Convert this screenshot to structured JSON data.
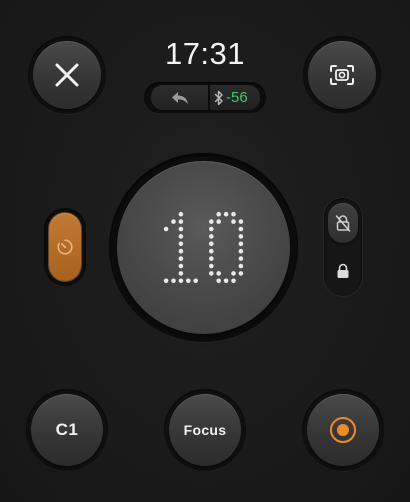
{
  "status": {
    "time": "17:31",
    "bluetooth_signal": "-56",
    "icons": {
      "reply": "reply-arrow-icon",
      "bluetooth": "bluetooth-icon"
    }
  },
  "controls": {
    "close_icon": "close-icon",
    "screenshot_icon": "screenshot-icon",
    "timer_icon": "timer-icon",
    "unlock_icon": "unlocked-crossed-icon",
    "lock_icon": "lock-icon",
    "record_icon": "record-icon"
  },
  "countdown": {
    "value": "10"
  },
  "buttons": {
    "c1_label": "C1",
    "focus_label": "Focus"
  },
  "colors": {
    "accent_orange": "#c27a34",
    "record_orange": "#ef8a2a",
    "signal_green": "#3ec96b",
    "background": "#1b1b1b"
  }
}
